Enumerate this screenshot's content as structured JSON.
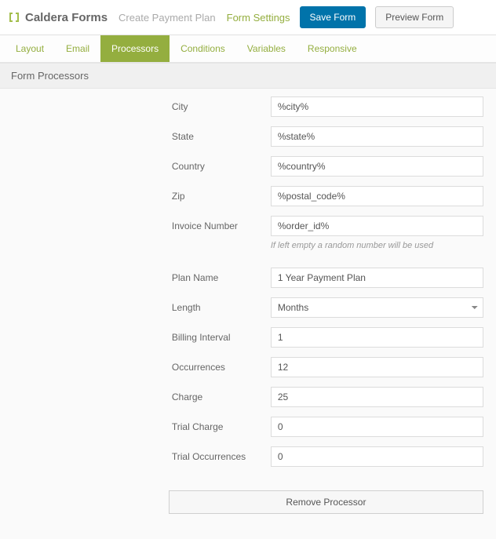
{
  "header": {
    "brand": "Caldera Forms",
    "crumb1": "Create Payment Plan",
    "crumb2": "Form Settings",
    "save_btn": "Save Form",
    "preview_btn": "Preview Form"
  },
  "tabs": {
    "layout": "Layout",
    "email": "Email",
    "processors": "Processors",
    "conditions": "Conditions",
    "variables": "Variables",
    "responsive": "Responsive"
  },
  "section_title": "Form Processors",
  "labels": {
    "city": "City",
    "state": "State",
    "country": "Country",
    "zip": "Zip",
    "invoice_number": "Invoice Number",
    "plan_name": "Plan Name",
    "length": "Length",
    "billing_interval": "Billing Interval",
    "occurrences": "Occurrences",
    "charge": "Charge",
    "trial_charge": "Trial Charge",
    "trial_occurrences": "Trial Occurrences"
  },
  "values": {
    "city": "%city%",
    "state": "%state%",
    "country": "%country%",
    "zip": "%postal_code%",
    "invoice_number": "%order_id%",
    "plan_name": "1 Year Payment Plan",
    "length": "Months",
    "billing_interval": "1",
    "occurrences": "12",
    "charge": "25",
    "trial_charge": "0",
    "trial_occurrences": "0"
  },
  "hints": {
    "invoice": "If left empty a random number will be used"
  },
  "buttons": {
    "remove": "Remove Processor"
  }
}
